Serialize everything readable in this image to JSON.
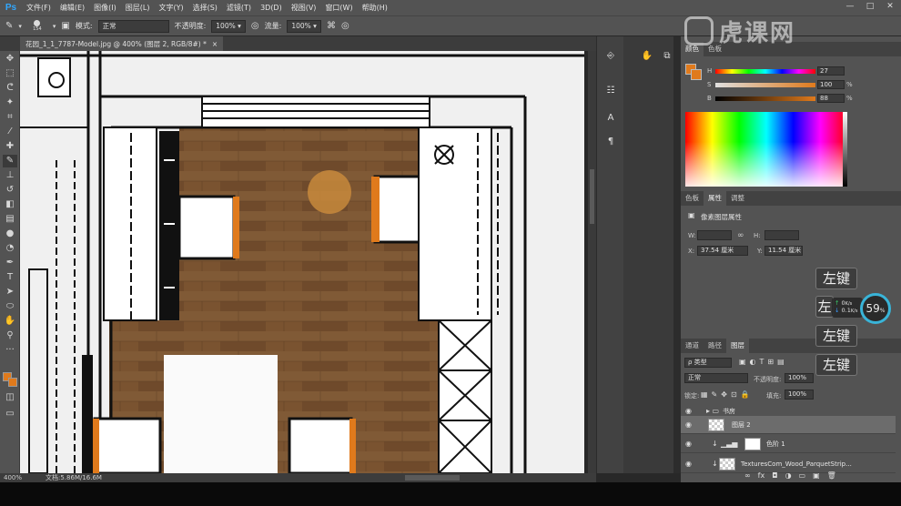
{
  "app": {
    "logo": "Ps"
  },
  "menu": [
    "文件(F)",
    "编辑(E)",
    "图像(I)",
    "图层(L)",
    "文字(Y)",
    "选择(S)",
    "滤镜(T)",
    "3D(D)",
    "视图(V)",
    "窗口(W)",
    "帮助(H)"
  ],
  "window_controls": [
    "—",
    "□",
    "✕"
  ],
  "options": {
    "brush_size": "154",
    "mode_label": "模式:",
    "mode_value": "正常",
    "opacity_label": "不透明度:",
    "opacity_value": "100%",
    "flow_label": "流量:",
    "flow_value": "100%"
  },
  "document_tab": {
    "title": "花园_1_1_7787-Model.jpg @ 400% (图层 2, RGB/8#) *",
    "close": "×"
  },
  "status": {
    "zoom": "400%",
    "doc_size": "文档:5.86M/16.6M"
  },
  "color_panel": {
    "tabs": [
      "颜色",
      "色板"
    ],
    "H": {
      "label": "H",
      "value": "27",
      "unit": ""
    },
    "S": {
      "label": "S",
      "value": "100",
      "unit": "%"
    },
    "B": {
      "label": "B",
      "value": "88",
      "unit": "%"
    },
    "foreground": "#e07a1c"
  },
  "properties_panel": {
    "tabs": [
      "色板",
      "属性",
      "调整"
    ],
    "active_tab": "属性",
    "heading": "像素图层属性",
    "w_label": "W:",
    "h_label": "H:",
    "link": "∞",
    "x_label": "X:",
    "x_value": "37.54 厘米",
    "y_label": "Y:",
    "y_value": "11.54 厘米"
  },
  "layers_panel": {
    "tabs": [
      "通道",
      "路径",
      "图层"
    ],
    "filter_kind": "ρ 类型",
    "blend_mode": "正常",
    "opacity_label": "不透明度:",
    "opacity_value": "100%",
    "lock_label": "锁定:",
    "fill_label": "填充:",
    "fill_value": "100%",
    "layers": [
      {
        "name": "书房",
        "type": "group"
      },
      {
        "name": "图层 2",
        "type": "pixel",
        "selected": true
      },
      {
        "name": "色阶 1",
        "type": "adjustment"
      },
      {
        "name": "TexturesCom_Wood_ParquetStrip...",
        "type": "pixel"
      }
    ],
    "footer_icons": [
      "∞",
      "fx",
      "◘",
      "◑",
      "▭",
      "▣",
      "🗑"
    ]
  },
  "overlay": {
    "keys": [
      "左键",
      "左",
      "左键",
      "左键"
    ],
    "net_up": "0",
    "net_up_unit": "K/s",
    "net_down": "0.1",
    "net_down_unit": "K/s",
    "cpu": "59",
    "cpu_unit": "%"
  },
  "watermark": "虎课网",
  "canvas_colors": {
    "wood": "#7a5330",
    "orange": "#e07a1c",
    "line": "#111111",
    "bg": "#f0f0f0"
  }
}
